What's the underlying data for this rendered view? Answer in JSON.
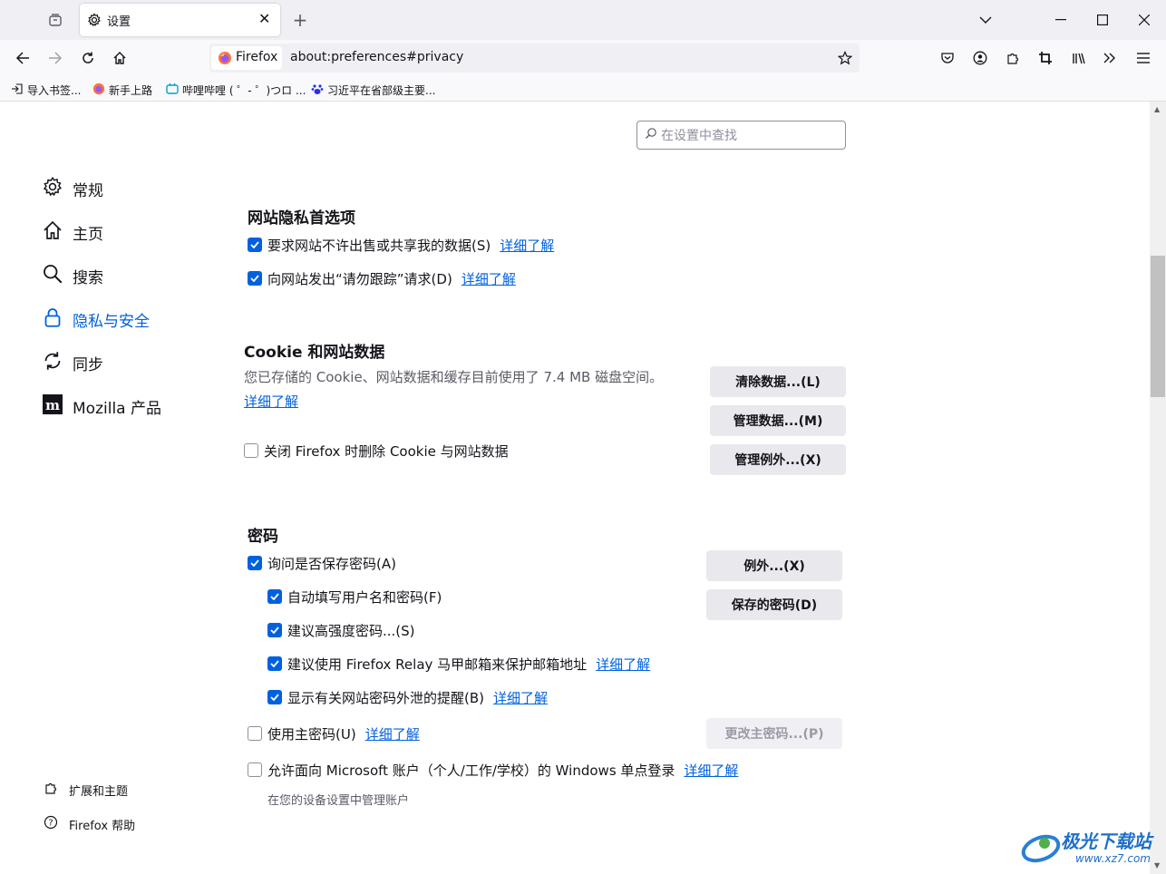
{
  "tab": {
    "title": "设置"
  },
  "urlbar": {
    "identity": "Firefox",
    "url": "about:preferences#privacy"
  },
  "bookmarks": [
    {
      "label": "导入书签...",
      "icon": "import-icon"
    },
    {
      "label": "新手上路",
      "icon": "firefox-icon"
    },
    {
      "label": "哔哩哔哩 ( ゜- ゜)つロ ...",
      "icon": "bilibili-icon"
    },
    {
      "label": "习近平在省部级主要...",
      "icon": "baidu-icon"
    }
  ],
  "search": {
    "placeholder": "在设置中查找"
  },
  "sidebar": {
    "items": [
      {
        "label": "常规",
        "icon": "gear-icon"
      },
      {
        "label": "主页",
        "icon": "home-icon"
      },
      {
        "label": "搜索",
        "icon": "search-icon"
      },
      {
        "label": "隐私与安全",
        "icon": "lock-icon",
        "active": true
      },
      {
        "label": "同步",
        "icon": "sync-icon"
      },
      {
        "label": "Mozilla 产品",
        "icon": "mozilla-icon"
      }
    ],
    "footer": [
      {
        "label": "扩展和主题",
        "icon": "puzzle-icon"
      },
      {
        "label": "Firefox 帮助",
        "icon": "help-icon"
      }
    ]
  },
  "privacy_prefs": {
    "title": "网站隐私首选项",
    "items": [
      {
        "label": "要求网站不许出售或共享我的数据(S)",
        "checked": true,
        "link": "详细了解"
      },
      {
        "label": "向网站发出“请勿跟踪”请求(D)",
        "checked": true,
        "link": "详细了解"
      }
    ]
  },
  "cookies": {
    "title": "Cookie 和网站数据",
    "description": "您已存储的 Cookie、网站数据和缓存目前使用了 7.4 MB 磁盘空间。",
    "learn_more": "详细了解",
    "delete_on_close": {
      "label": "关闭 Firefox 时删除 Cookie 与网站数据",
      "checked": false
    },
    "buttons": {
      "clear": "清除数据...(L)",
      "manage": "管理数据...(M)",
      "exceptions": "管理例外...(X)"
    }
  },
  "passwords": {
    "title": "密码",
    "ask_save": {
      "label": "询问是否保存密码(A)",
      "checked": true
    },
    "sub_items": [
      {
        "label": "自动填写用户名和密码(F)",
        "checked": true,
        "link": ""
      },
      {
        "label": "建议高强度密码...(S)",
        "checked": true,
        "link": ""
      },
      {
        "label": "建议使用 Firefox Relay 马甲邮箱来保护邮箱地址",
        "checked": true,
        "link": "详细了解"
      },
      {
        "label": "显示有关网站密码外泄的提醒(B)",
        "checked": true,
        "link": "详细了解"
      }
    ],
    "primary_password": {
      "label": "使用主密码(U)",
      "checked": false,
      "link": "详细了解"
    },
    "windows_sso": {
      "label": "允许面向 Microsoft 账户（个人/工作/学校）的 Windows 单点登录",
      "checked": false,
      "link": "详细了解"
    },
    "windows_sso_note": "在您的设备设置中管理账户",
    "buttons": {
      "exceptions": "例外...(X)",
      "saved": "保存的密码(D)",
      "change_primary": "更改主密码...(P)"
    }
  },
  "watermark": {
    "text": "极光下载站",
    "url": "www.xz7.com"
  },
  "colors": {
    "accent": "#0061e0",
    "toolbar": "#f0f0f4",
    "button": "#e9e9ed"
  }
}
